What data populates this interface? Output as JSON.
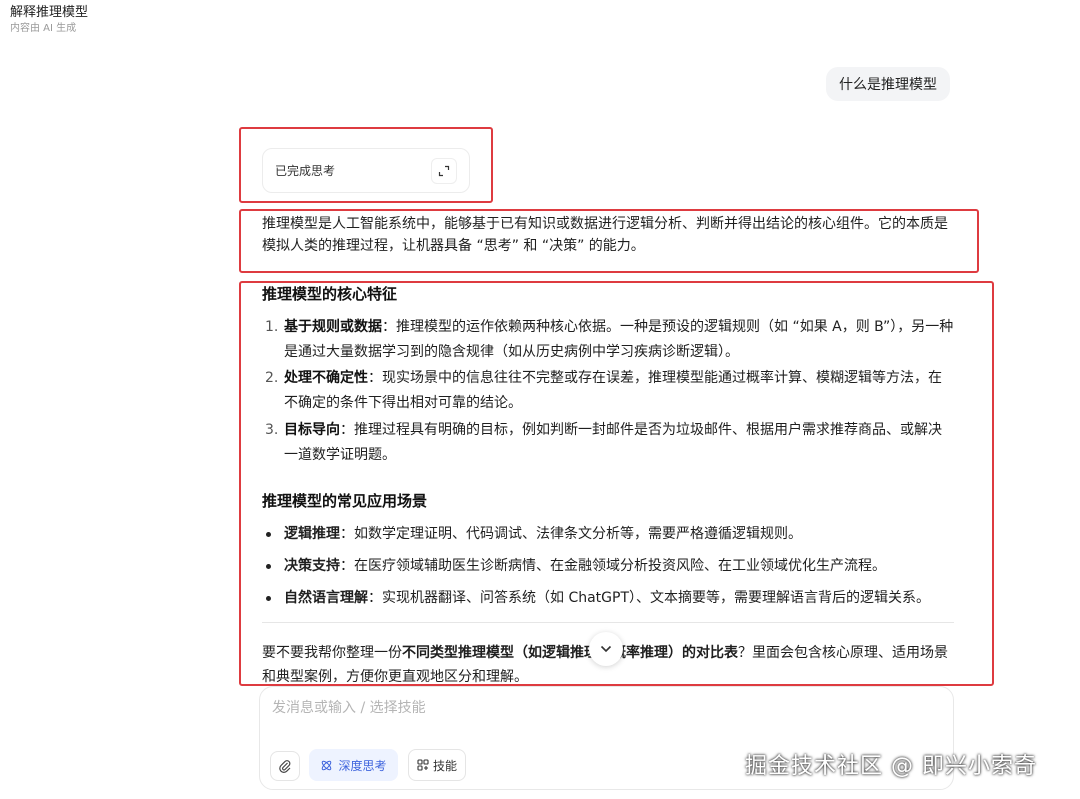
{
  "header": {
    "title": "解释推理模型",
    "subtitle": "内容由 AI 生成"
  },
  "user_message": "什么是推理模型",
  "thinking": {
    "label": "已完成思考",
    "expand_icon": "expand-icon"
  },
  "intro": "推理模型是人工智能系统中，能够基于已有知识或数据进行逻辑分析、判断并得出结论的核心组件。它的本质是模拟人类的推理过程，让机器具备 “思考” 和 “决策” 的能力。",
  "features": {
    "heading": "推理模型的核心特征",
    "items": [
      {
        "num": "1.",
        "term": "基于规则或数据",
        "text": "：推理模型的运作依赖两种核心依据。一种是预设的逻辑规则（如 “如果 A，则 B”），另一种是通过大量数据学习到的隐含规律（如从历史病例中学习疾病诊断逻辑）。"
      },
      {
        "num": "2.",
        "term": "处理不确定性",
        "text": "：现实场景中的信息往往不完整或存在误差，推理模型能通过概率计算、模糊逻辑等方法，在不确定的条件下得出相对可靠的结论。"
      },
      {
        "num": "3.",
        "term": "目标导向",
        "text": "：推理过程具有明确的目标，例如判断一封邮件是否为垃圾邮件、根据用户需求推荐商品、或解决一道数学证明题。"
      }
    ]
  },
  "applications": {
    "heading": "推理模型的常见应用场景",
    "items": [
      {
        "term": "逻辑推理",
        "text": "：如数学定理证明、代码调试、法律条文分析等，需要严格遵循逻辑规则。"
      },
      {
        "term": "决策支持",
        "text": "：在医疗领域辅助医生诊断病情、在金融领域分析投资风险、在工业领域优化生产流程。"
      },
      {
        "term": "自然语言理解",
        "text": "：实现机器翻译、问答系统（如 ChatGPT）、文本摘要等，需要理解语言背后的逻辑关系。"
      }
    ]
  },
  "followup": {
    "prefix": "要不要我帮你整理一份",
    "bold": "不同类型推理模型（如逻辑推理、概率推理）的对比表",
    "suffix": "？里面会包含核心原理、适用场景和典型案例，方便你更直观地区分和理解。"
  },
  "composer": {
    "placeholder": "发消息或输入 / 选择技能",
    "deep_think_label": "深度思考",
    "skills_label": "技能"
  },
  "watermark": "掘金技术社区 @ 即兴小索奇",
  "colors": {
    "highlight_border": "#de3b40",
    "accent": "#3d63dd"
  }
}
